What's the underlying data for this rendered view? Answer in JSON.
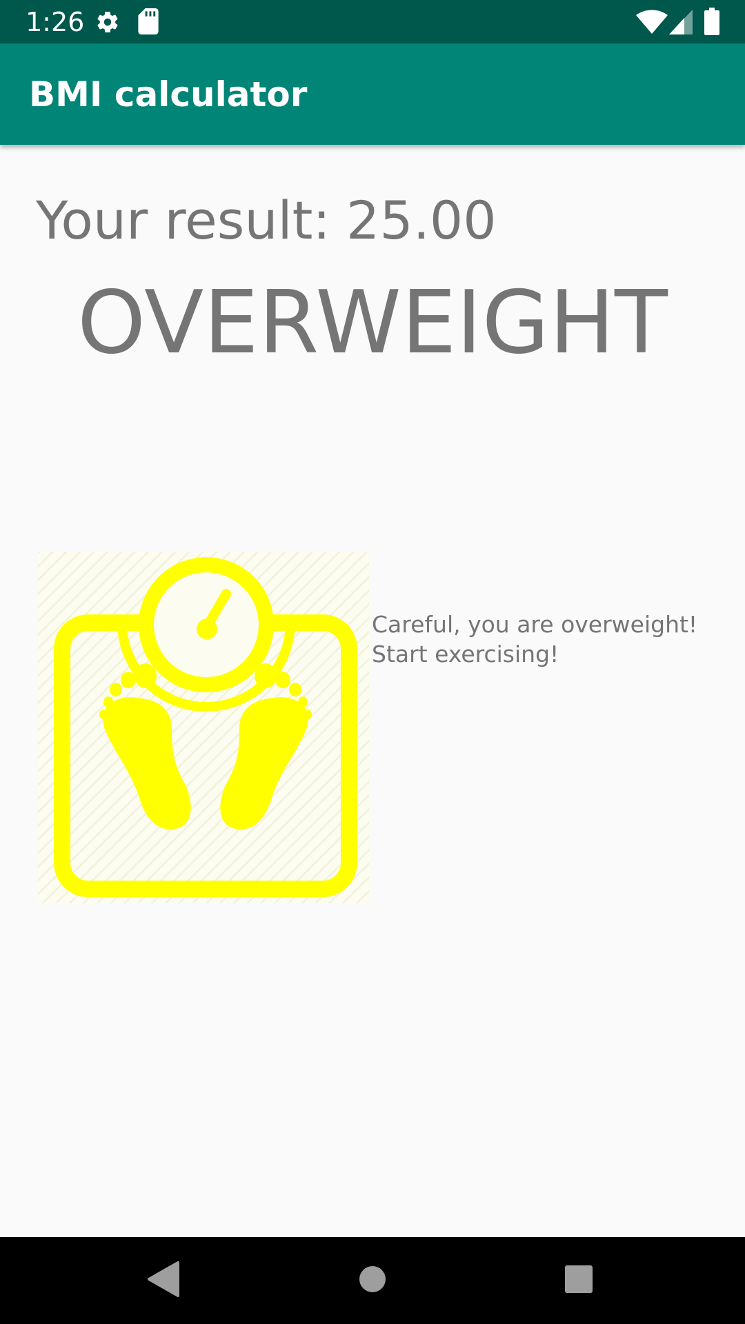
{
  "status_bar": {
    "time": "1:26",
    "icons": [
      "gear-icon",
      "sd-card-icon",
      "wifi-icon",
      "signal-icon",
      "battery-icon"
    ]
  },
  "app_bar": {
    "title": "BMI calculator"
  },
  "result": {
    "label": "Your result:",
    "value": "25.00",
    "category": "OVERWEIGHT"
  },
  "illustration": {
    "icon": "bathroom-scale-footprints-icon",
    "color": "#ffff00"
  },
  "advice": {
    "line1": "Careful, you are overweight!",
    "line2": "Start exercising!"
  },
  "nav_bar": {
    "icons": [
      "back-icon",
      "home-icon",
      "recents-icon"
    ]
  },
  "colors": {
    "status_bar": "#00574b",
    "app_bar": "#008577",
    "text": "#757575",
    "background": "#fafafa",
    "nav_bar": "#000000"
  }
}
